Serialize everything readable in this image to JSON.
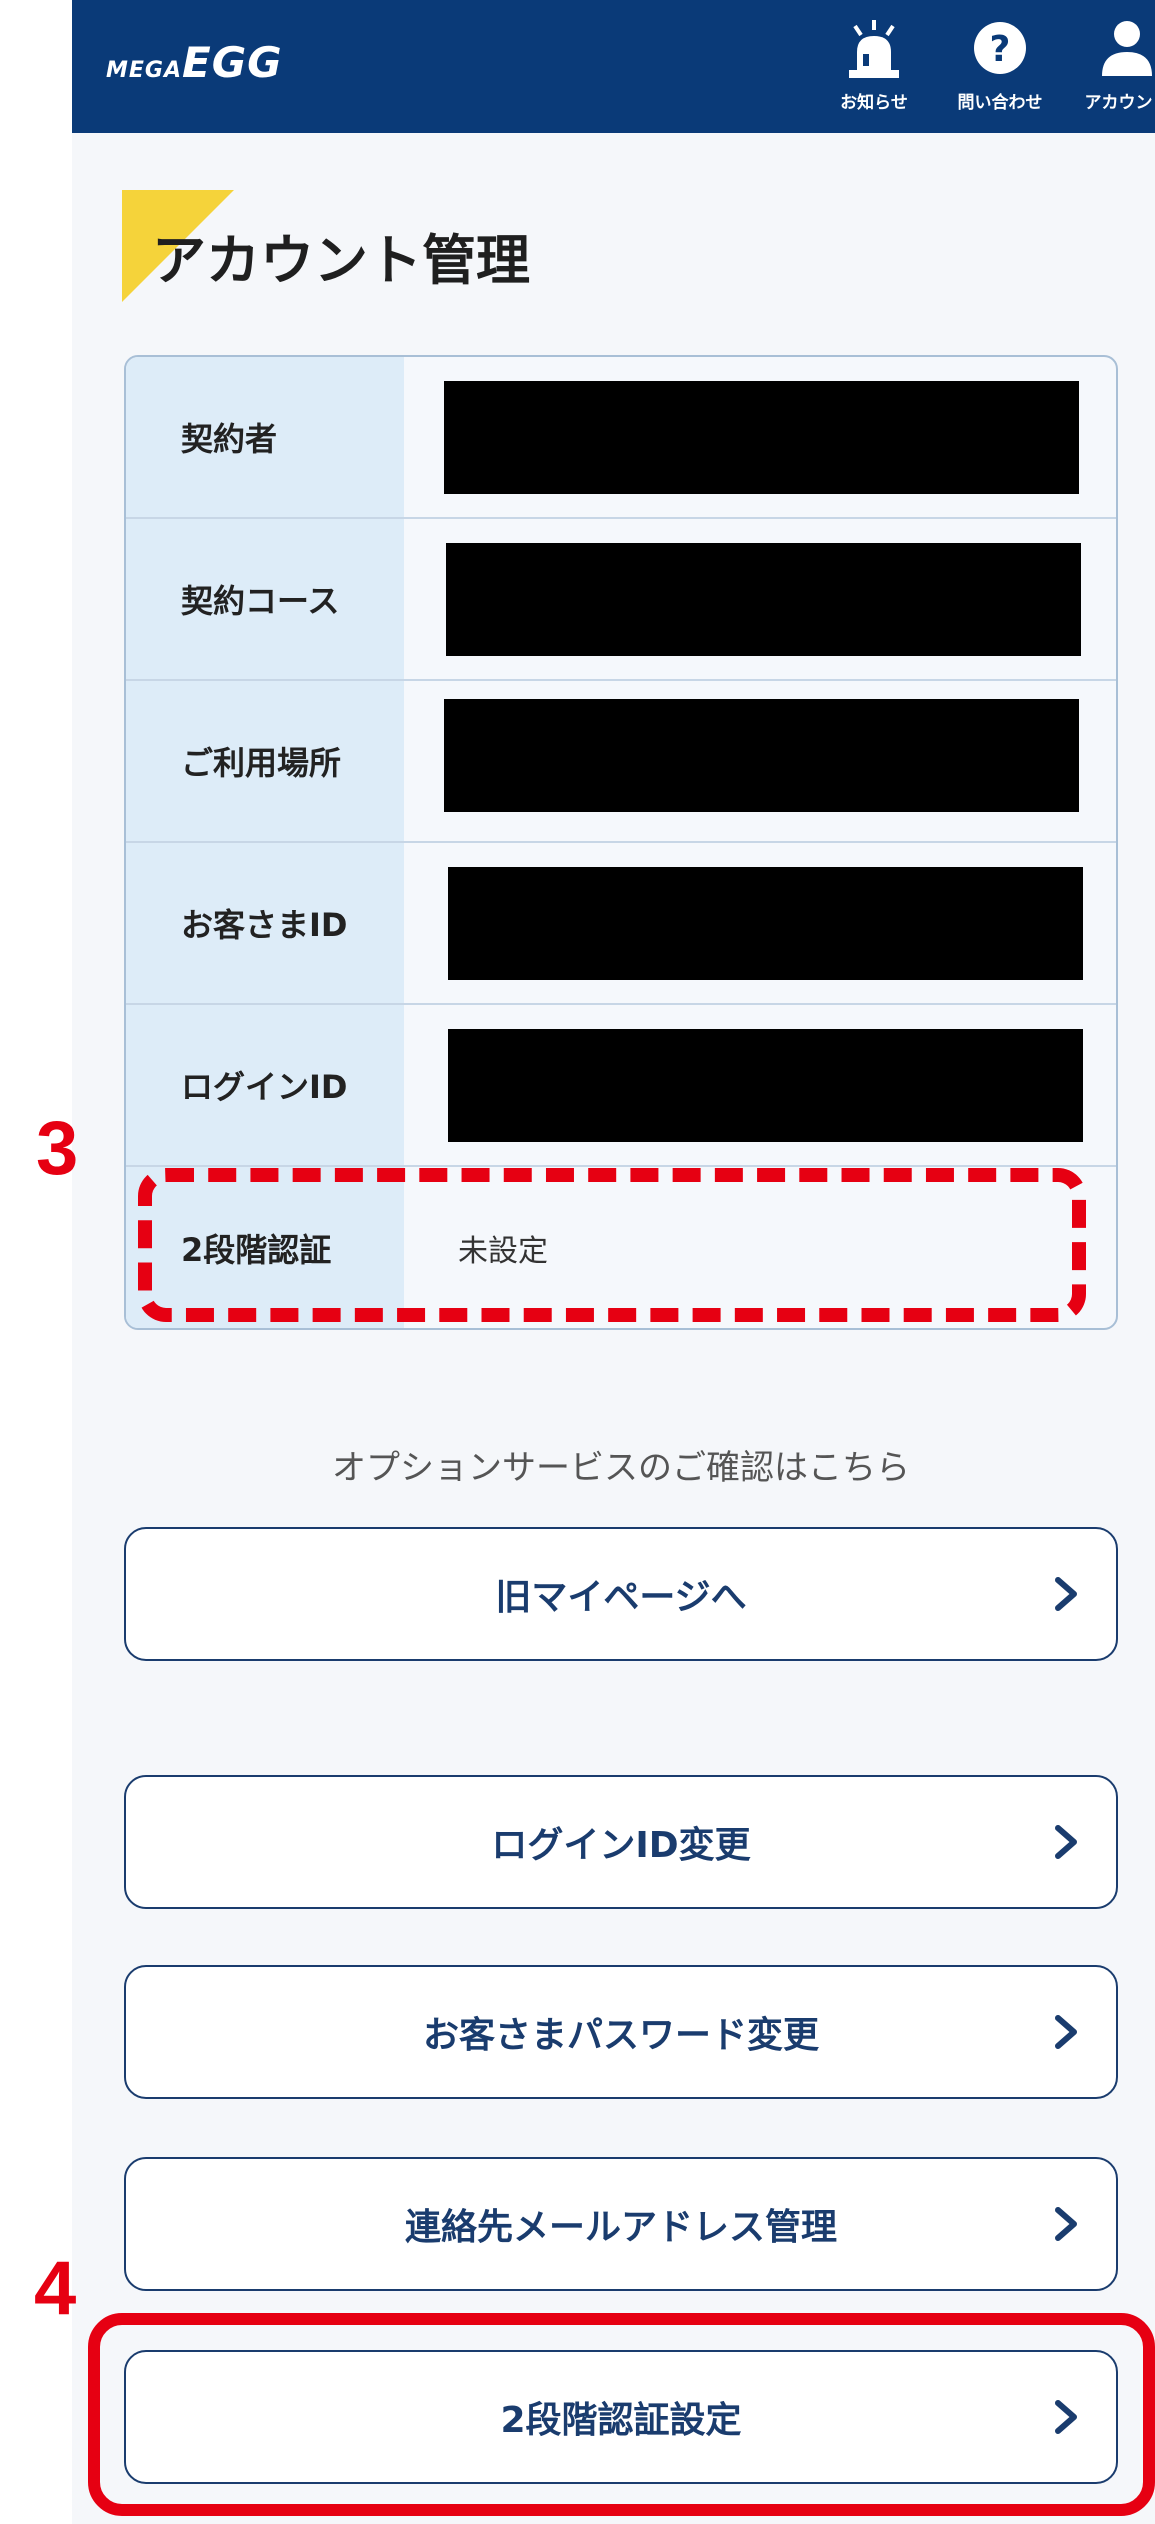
{
  "header": {
    "logo_small": "MEGA",
    "logo_big": "EGG",
    "nav": [
      {
        "label": "お知らせ",
        "icon": "notification-siren-icon"
      },
      {
        "label": "問い合わせ",
        "icon": "question-icon"
      },
      {
        "label": "アカウント",
        "icon": "user-icon"
      }
    ]
  },
  "page_title": "アカウント管理",
  "account_table": [
    {
      "label": "契約者",
      "value": "",
      "redacted": true
    },
    {
      "label": "契約コース",
      "value": "",
      "redacted": true
    },
    {
      "label": "ご利用場所",
      "value": "",
      "redacted": true
    },
    {
      "label": "お客さまID",
      "value": "",
      "redacted": true
    },
    {
      "label": "ログインID",
      "value": "",
      "redacted": true
    },
    {
      "label": "2段階認証",
      "value": "未設定",
      "redacted": false
    }
  ],
  "option_caption": "オプションサービスのご確認はこちら",
  "buttons": [
    {
      "label": "旧マイページへ"
    },
    {
      "label": "ログインID変更"
    },
    {
      "label": "お客さまパスワード変更"
    },
    {
      "label": "連絡先メールアドレス管理"
    },
    {
      "label": "2段階認証設定"
    }
  ],
  "annotations": {
    "step3": "3",
    "step4": "4",
    "color": "#e60012"
  },
  "colors": {
    "header_bg": "#0a3a78",
    "title_accent": "#f5d33a",
    "label_bg": "#ddecf8",
    "button_border": "#1a3c6e"
  }
}
